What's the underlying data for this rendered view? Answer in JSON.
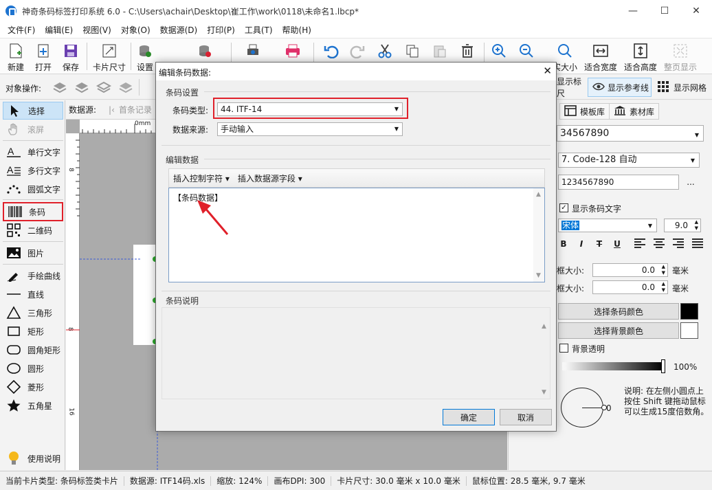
{
  "window": {
    "title": "神奇条码标签打印系统 6.0 - C:\\Users\\achair\\Desktop\\崔工作\\work\\0118\\未命名1.lbcp*",
    "minimize": "—",
    "maximize": "☐",
    "close": "✕"
  },
  "menu": [
    "文件(F)",
    "编辑(E)",
    "视图(V)",
    "对象(O)",
    "数据源(D)",
    "打印(P)",
    "工具(T)",
    "帮助(H)"
  ],
  "toolbar": {
    "new": "新建",
    "open": "打开",
    "save": "保存",
    "card_size": "卡片尺寸",
    "settings": "设置",
    "actual_size": "实大小",
    "fit_width": "适合宽度",
    "fit_height": "适合高度",
    "full_page": "整页显示"
  },
  "object_bar": {
    "label": "对象操作:",
    "show_ruler": "显示标尺",
    "show_guides": "显示参考线",
    "show_grid": "显示网格"
  },
  "left_tools": {
    "select": "选择",
    "scroll": "滚屏",
    "single_text": "单行文字",
    "multi_text": "多行文字",
    "arc_text": "圆弧文字",
    "barcode": "条码",
    "qrcode": "二维码",
    "image": "图片",
    "freehand": "手绘曲线",
    "line": "直线",
    "triangle": "三角形",
    "rectangle": "矩形",
    "rounded_rect": "圆角矩形",
    "circle": "圆形",
    "diamond": "菱形",
    "star": "五角星",
    "help": "使用说明"
  },
  "canvas": {
    "datasource_label": "数据源:",
    "first_record": "首条记录",
    "ruler_unit": "0mm",
    "ruler_v_8": "8",
    "ruler_v_16": "16"
  },
  "dialog": {
    "title": "编辑条码数据:",
    "close": "✕",
    "group_settings": "条码设置",
    "type_label": "条码类型:",
    "type_value": "44. ITF-14",
    "source_label": "数据来源:",
    "source_value": "手动输入",
    "group_edit": "编辑数据",
    "insert_control": "插入控制字符",
    "insert_field": "插入数据源字段",
    "editor_content": "【条码数据】",
    "group_desc": "条码说明",
    "ok": "确定",
    "cancel": "取消"
  },
  "right_panel": {
    "tab_template": "模板库",
    "tab_material": "素材库",
    "data_value": "34567890",
    "barcode_type": "7. Code-128 自动",
    "barcode_data": "1234567890",
    "browse": "...",
    "show_text": "显示条码文字",
    "font": "宋体",
    "font_size": "9.0",
    "bold": "B",
    "italic": "I",
    "strike": "T",
    "underline": "U",
    "frame1_label": "框大小:",
    "frame1_value": "0.0",
    "frame2_label": "框大小:",
    "frame2_value": "0.0",
    "unit_mm": "毫米",
    "barcode_color": "选择条码颜色",
    "bg_color": "选择背景颜色",
    "transparent": "背景透明",
    "opacity": "100%",
    "angle": "0",
    "note": "说明: 在左侧小圆点上按住 Shift 键拖动鼠标可以生成15度倍数角。",
    "barcode_color_hex": "#000000",
    "bg_color_hex": "#ffffff"
  },
  "status": {
    "card_type": "当前卡片类型: 条码标签类卡片",
    "datasource": "数据源: ITF14码.xls",
    "zoom": "缩放: 124%",
    "dpi": "画布DPI: 300",
    "card_size": "卡片尺寸: 30.0 毫米 x 10.0 毫米",
    "mouse_pos": "鼠标位置: 28.5 毫米, 9.7 毫米"
  },
  "colors": {
    "accent_red": "#e0202a",
    "selected_blue": "#cce4f7"
  }
}
